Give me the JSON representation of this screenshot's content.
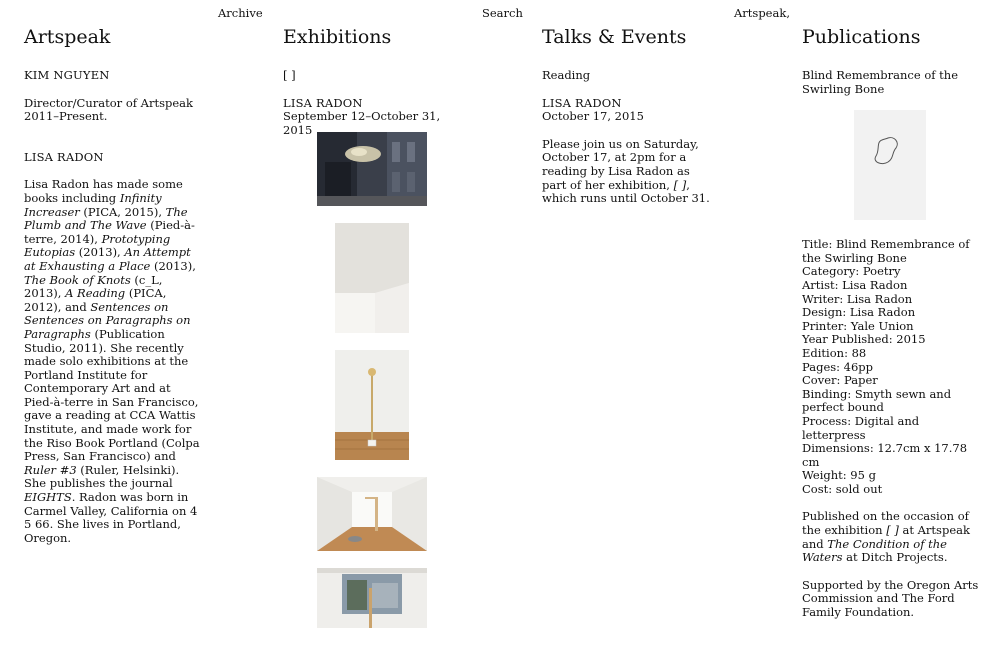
{
  "nav": {
    "archive": "Archive",
    "search": "Search",
    "artspeak": "Artspeak,"
  },
  "col1": {
    "title": "Artspeak",
    "name": "KIM NGUYEN",
    "role_line1": "Director/Curator of Artspeak",
    "role_line2": "2011–Present.",
    "artist": "LISA RADON",
    "bio": [
      {
        "t": "Lisa Radon has made some books including "
      },
      {
        "t": "Infinity Increaser",
        "i": true
      },
      {
        "t": " (PICA, 2015), "
      },
      {
        "t": "The Plumb and The Wave",
        "i": true
      },
      {
        "t": " (Pied-à-terre, 2014), "
      },
      {
        "t": "Prototyping Eutopias",
        "i": true
      },
      {
        "t": " (2013), "
      },
      {
        "t": "An Attempt at Exhausting a Place",
        "i": true
      },
      {
        "t": " (2013), "
      },
      {
        "t": "The Book of Knots",
        "i": true
      },
      {
        "t": " (c_L, 2013), "
      },
      {
        "t": "A Reading",
        "i": true
      },
      {
        "t": " (PICA, 2012), and "
      },
      {
        "t": "Sentences on Sentences on Paragraphs on Paragraphs",
        "i": true
      },
      {
        "t": " (Publication Studio, 2011). She recently made solo exhibitions at the Portland Institute for Contemporary Art and at Pied-à-terre in San Francisco, gave a reading at CCA Wattis Institute, and made work for the Riso Book Portland (Colpa Press, San Francisco) and "
      },
      {
        "t": "Ruler #3",
        "i": true
      },
      {
        "t": " (Ruler, Helsinki). She publishes the journal "
      },
      {
        "t": "EIGHTS",
        "i": true
      },
      {
        "t": ". Radon was born in Carmel Valley, California on 4 5 66. She lives in Portland, Oregon."
      }
    ]
  },
  "col2": {
    "title": "Exhibitions",
    "exhibition": "[ ]",
    "artist": "LISA RADON",
    "dates": "September 12–October 31, 2015"
  },
  "col3": {
    "title": "Talks & Events",
    "type": "Reading",
    "artist": "LISA RADON",
    "date": "October 17, 2015",
    "body": [
      {
        "t": "Please join us on Saturday, October 17, at 2pm for a reading by Lisa Radon as part of her exhibition, "
      },
      {
        "t": "[ ]",
        "i": true
      },
      {
        "t": ", which runs until October 31."
      }
    ]
  },
  "col4": {
    "title": "Publications",
    "pub_title": "Blind Remembrance of the Swirling Bone",
    "details": [
      "Title: Blind Remembrance of the Swirling Bone",
      "Category: Poetry",
      "Artist: Lisa Radon",
      "Writer: Lisa Radon",
      "Design: Lisa Radon",
      "Printer: Yale Union",
      "Year Published: 2015",
      "Edition: 88",
      "Pages: 46pp",
      "Cover: Paper",
      "Binding: Smyth sewn and perfect bound",
      "Process: Digital and letterpress",
      "Dimensions: 12.7cm x 17.78 cm",
      "Weight: 95 g",
      "Cost: sold out"
    ],
    "published": [
      {
        "t": "Published on the occasion of the exhibition "
      },
      {
        "t": "[ ]",
        "i": true
      },
      {
        "t": " at Artspeak and "
      },
      {
        "t": "The Condition of the Waters",
        "i": true
      },
      {
        "t": " at Ditch Projects."
      }
    ],
    "supported": "Supported by the Oregon Arts Commission and The Ford Family Foundation."
  }
}
